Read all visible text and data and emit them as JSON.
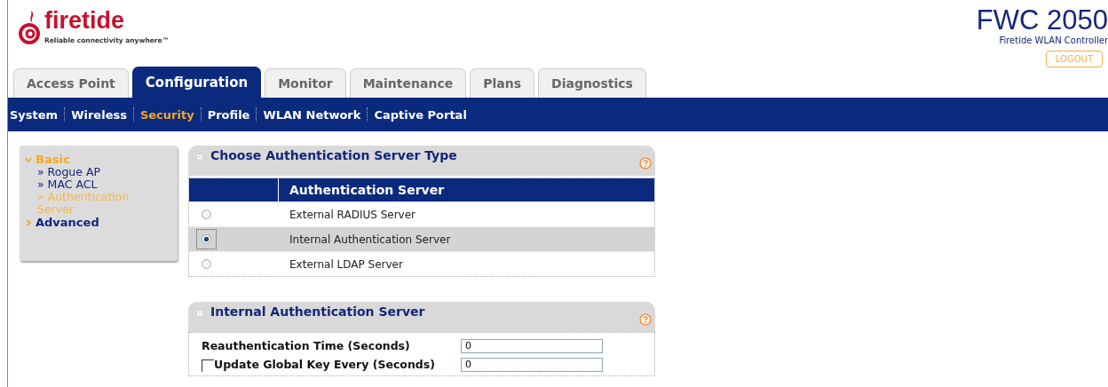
{
  "logo": {
    "name": "firetide",
    "tagline": "Reliable connectivity anywhere™"
  },
  "product": {
    "model": "FWC 2050",
    "subtitle": "Firetide WLAN Controller"
  },
  "logout": "LOGOUT",
  "tabs": [
    {
      "label": "Access Point",
      "selected": false
    },
    {
      "label": "Configuration",
      "selected": true
    },
    {
      "label": "Monitor",
      "selected": false
    },
    {
      "label": "Maintenance",
      "selected": false
    },
    {
      "label": "Plans",
      "selected": false
    },
    {
      "label": "Diagnostics",
      "selected": false
    }
  ],
  "subnav": [
    {
      "label": "System",
      "selected": false
    },
    {
      "label": "Wireless",
      "selected": false
    },
    {
      "label": "Security",
      "selected": true
    },
    {
      "label": "Profile",
      "selected": false
    },
    {
      "label": "WLAN Network",
      "selected": false
    },
    {
      "label": "Captive Portal",
      "selected": false
    }
  ],
  "sidebar": [
    {
      "label": "Basic",
      "expanded": true,
      "selected": true,
      "children": [
        {
          "label": "» Rogue AP",
          "selected": false
        },
        {
          "label": "» MAC ACL",
          "selected": false
        },
        {
          "label": "» Authentication Server",
          "selected": true
        }
      ]
    },
    {
      "label": "Advanced",
      "expanded": false,
      "selected": false
    }
  ],
  "auth_panel": {
    "title": "Choose Authentication Server Type",
    "column": "Authentication Server",
    "options": [
      {
        "label": "External RADIUS Server",
        "selected": false
      },
      {
        "label": "Internal Authentication Server",
        "selected": true
      },
      {
        "label": "External LDAP Server",
        "selected": false
      }
    ]
  },
  "internal_panel": {
    "title": "Internal Authentication Server",
    "fields": [
      {
        "kind": "text",
        "label": "Reauthentication Time (Seconds)",
        "value": "0"
      },
      {
        "kind": "checkbox",
        "label": "Update Global Key Every (Seconds)",
        "checked": false,
        "value": "0"
      }
    ]
  }
}
